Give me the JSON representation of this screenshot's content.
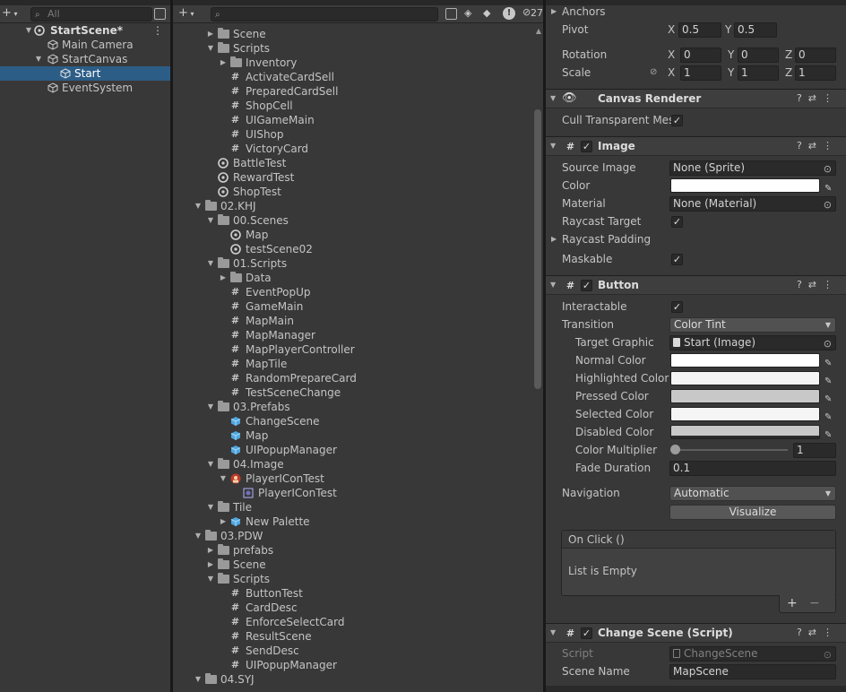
{
  "hierarchy": {
    "search_placeholder": "All",
    "items": [
      {
        "label": "StartScene*",
        "bold": true
      },
      {
        "label": "Main Camera"
      },
      {
        "label": "StartCanvas"
      },
      {
        "label": "Start"
      },
      {
        "label": "EventSystem"
      }
    ],
    "menu_icon": "⋮"
  },
  "project": {
    "badge_count": "27",
    "rows": [
      {
        "label": "Scene",
        "type": "folder"
      },
      {
        "label": "Scripts",
        "type": "folder"
      },
      {
        "label": "Inventory",
        "type": "folder"
      },
      {
        "label": "ActivateCardSell",
        "type": "script"
      },
      {
        "label": "PreparedCardSell",
        "type": "script"
      },
      {
        "label": "ShopCell",
        "type": "script"
      },
      {
        "label": "UIGameMain",
        "type": "script"
      },
      {
        "label": "UIShop",
        "type": "script"
      },
      {
        "label": "VictoryCard",
        "type": "script"
      },
      {
        "label": "BattleTest",
        "type": "scene"
      },
      {
        "label": "RewardTest",
        "type": "scene"
      },
      {
        "label": "ShopTest",
        "type": "scene"
      },
      {
        "label": "02.KHJ",
        "type": "folder"
      },
      {
        "label": "00.Scenes",
        "type": "folder"
      },
      {
        "label": "Map",
        "type": "scene"
      },
      {
        "label": "testScene02",
        "type": "scene"
      },
      {
        "label": "01.Scripts",
        "type": "folder"
      },
      {
        "label": "Data",
        "type": "folder"
      },
      {
        "label": "EventPopUp",
        "type": "script"
      },
      {
        "label": "GameMain",
        "type": "script"
      },
      {
        "label": "MapMain",
        "type": "script"
      },
      {
        "label": "MapManager",
        "type": "script"
      },
      {
        "label": "MapPlayerController",
        "type": "script"
      },
      {
        "label": "MapTile",
        "type": "script"
      },
      {
        "label": "RandomPrepareCard",
        "type": "script"
      },
      {
        "label": "TestSceneChange",
        "type": "script"
      },
      {
        "label": "03.Prefabs",
        "type": "folder"
      },
      {
        "label": "ChangeScene",
        "type": "prefab"
      },
      {
        "label": "Map",
        "type": "prefab"
      },
      {
        "label": "UIPopupManager",
        "type": "prefab"
      },
      {
        "label": "04.Image",
        "type": "folder"
      },
      {
        "label": "PlayerIConTest",
        "type": "image"
      },
      {
        "label": "PlayerIConTest",
        "type": "sprite"
      },
      {
        "label": "Tile",
        "type": "folder"
      },
      {
        "label": "New Palette",
        "type": "prefab"
      },
      {
        "label": "03.PDW",
        "type": "folder"
      },
      {
        "label": "prefabs",
        "type": "folder"
      },
      {
        "label": "Scene",
        "type": "folder"
      },
      {
        "label": "Scripts",
        "type": "folder"
      },
      {
        "label": "ButtonTest",
        "type": "script"
      },
      {
        "label": "CardDesc",
        "type": "script"
      },
      {
        "label": "EnforceSelectCard",
        "type": "script"
      },
      {
        "label": "ResultScene",
        "type": "script"
      },
      {
        "label": "SendDesc",
        "type": "script"
      },
      {
        "label": "UIPopupManager",
        "type": "script"
      },
      {
        "label": "04.SYJ",
        "type": "folder"
      }
    ]
  },
  "inspector": {
    "anchors_label": "Anchors",
    "pivot": {
      "label": "Pivot",
      "x": "0.5",
      "y": "0.5"
    },
    "rotation": {
      "label": "Rotation",
      "x": "0",
      "y": "0",
      "z": "0"
    },
    "scale": {
      "label": "Scale",
      "x": "1",
      "y": "1",
      "z": "1"
    },
    "axis_x": "X",
    "axis_y": "Y",
    "axis_z": "Z",
    "canvas_renderer": {
      "title": "Canvas Renderer",
      "cull_label": "Cull Transparent Mes"
    },
    "image": {
      "title": "Image",
      "source_image_label": "Source Image",
      "source_image_value": "None (Sprite)",
      "color_label": "Color",
      "material_label": "Material",
      "material_value": "None (Material)",
      "raycast_target_label": "Raycast Target",
      "raycast_padding_label": "Raycast Padding",
      "maskable_label": "Maskable"
    },
    "button": {
      "title": "Button",
      "interactable_label": "Interactable",
      "transition_label": "Transition",
      "transition_value": "Color Tint",
      "target_graphic_label": "Target Graphic",
      "target_graphic_value": "Start (Image)",
      "normal_color_label": "Normal Color",
      "highlighted_color_label": "Highlighted Color",
      "pressed_color_label": "Pressed Color",
      "selected_color_label": "Selected Color",
      "disabled_color_label": "Disabled Color",
      "color_multiplier_label": "Color Multiplier",
      "color_multiplier_value": "1",
      "fade_duration_label": "Fade Duration",
      "fade_duration_value": "0.1",
      "navigation_label": "Navigation",
      "navigation_value": "Automatic",
      "visualize_label": "Visualize",
      "onclick_label": "On Click ()",
      "list_empty_label": "List is Empty",
      "plus": "+",
      "minus": "−"
    },
    "change_scene": {
      "title": "Change Scene (Script)",
      "script_label": "Script",
      "script_value": "ChangeScene",
      "scene_name_label": "Scene Name",
      "scene_name_value": "MapScene"
    },
    "colors": {
      "white": "#ffffff",
      "highlighted": "#f5f5f5",
      "pressed": "#c8c8c8",
      "selected": "#f5f5f5",
      "disabled": "#c8c8c8"
    }
  }
}
